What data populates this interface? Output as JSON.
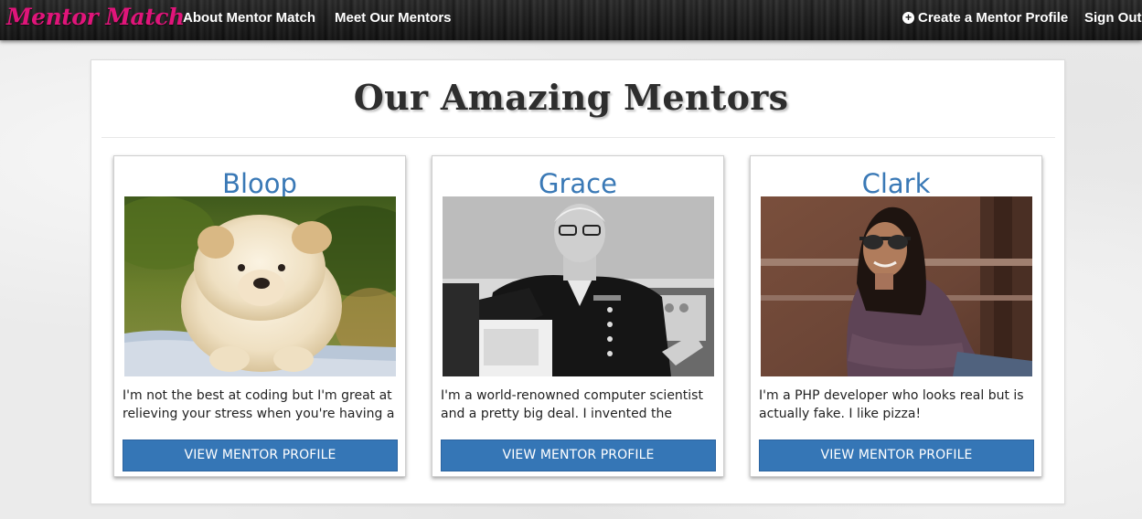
{
  "navbar": {
    "brand": "Mentor Match",
    "links": [
      "About Mentor Match",
      "Meet Our Mentors"
    ],
    "create_profile": "Create a Mentor Profile",
    "sign_out": "Sign Out",
    "brand_color": "#e0157a"
  },
  "main": {
    "title": "Our Amazing Mentors",
    "button_color": "#3576b6",
    "name_color": "#3a79b6"
  },
  "mentors": [
    {
      "name": "Bloop",
      "photo_icon": "puppy-photo",
      "bio": "I'm not the best at coding but I'm great at relieving your stress when you're having a",
      "button": "VIEW MENTOR PROFILE"
    },
    {
      "name": "Grace",
      "photo_icon": "grace-photo",
      "bio": "I'm a world-renowned computer scientist and a pretty big deal. I invented the compiler.",
      "button": "VIEW MENTOR PROFILE"
    },
    {
      "name": "Clark",
      "photo_icon": "clark-photo",
      "bio": "I'm a PHP developer who looks real but is actually fake. I like pizza!",
      "button": "VIEW MENTOR PROFILE"
    }
  ]
}
